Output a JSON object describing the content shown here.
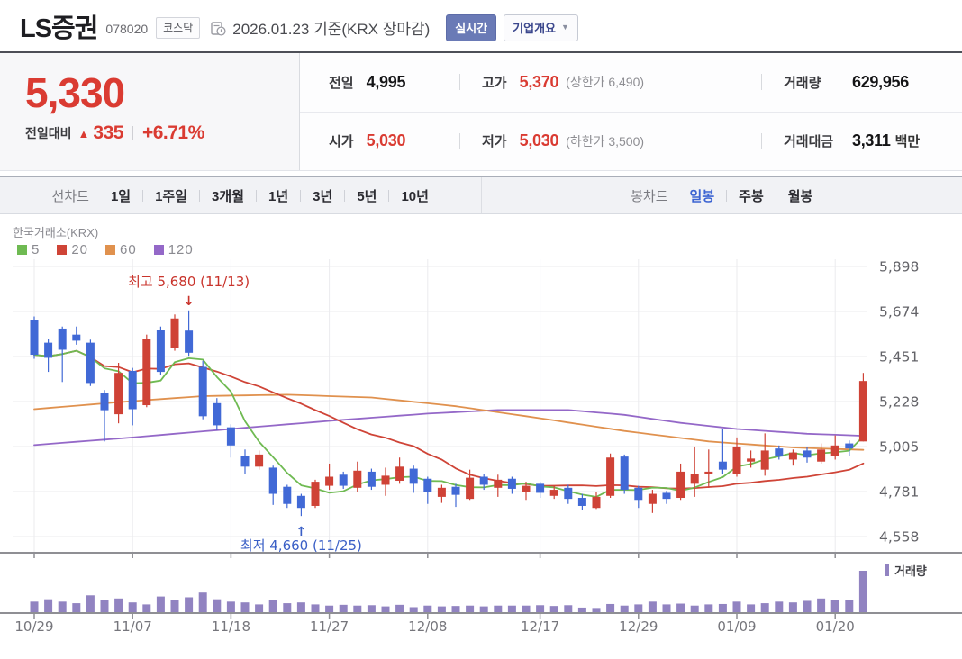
{
  "header": {
    "title": "LS증권",
    "code": "078020",
    "market_badge": "코스닥",
    "date_info": "2026.01.23  기준(KRX 장마감)",
    "realtime_badge": "실시간",
    "company_overview_button": "기업개요"
  },
  "quote": {
    "price": "5,330",
    "change_label": "전일대비",
    "change_triangle": "▲",
    "change_value": "335",
    "change_percent": "+6.71%",
    "rows": [
      {
        "cells": [
          {
            "label": "전일",
            "value": "4,995",
            "red": false,
            "sub": "",
            "suffix": ""
          },
          {
            "label": "고가",
            "value": "5,370",
            "red": true,
            "sub": "(상한가 6,490)",
            "suffix": ""
          },
          {
            "label": "거래량",
            "value": "629,956",
            "red": false,
            "sub": "",
            "suffix": ""
          }
        ]
      },
      {
        "cells": [
          {
            "label": "시가",
            "value": "5,030",
            "red": true,
            "sub": "",
            "suffix": ""
          },
          {
            "label": "저가",
            "value": "5,030",
            "red": true,
            "sub": "(하한가 3,500)",
            "suffix": ""
          },
          {
            "label": "거래대금",
            "value": "3,311",
            "red": false,
            "sub": "",
            "suffix": "백만"
          }
        ]
      }
    ]
  },
  "tabs": {
    "line_group_label": "선차트",
    "line_tabs": [
      "1일",
      "1주일",
      "3개월",
      "1년",
      "3년",
      "5년",
      "10년"
    ],
    "candle_group_label": "봉차트",
    "candle_tabs": [
      "일봉",
      "주봉",
      "월봉"
    ],
    "active_candle_tab": "일봉"
  },
  "chart_data": {
    "type": "candlestick",
    "source": "한국거래소(KRX)",
    "ma_legend": [
      {
        "label": "5",
        "color": "#6fba52"
      },
      {
        "label": "20",
        "color": "#cf4437"
      },
      {
        "label": "60",
        "color": "#e0914e"
      },
      {
        "label": "120",
        "color": "#9468c8"
      }
    ],
    "colors": {
      "up": "#cf4236",
      "down": "#4169d6",
      "volume": "#9183c1",
      "grid": "#ebebee",
      "axis": "#8f8f94",
      "label": "#6e6e73"
    },
    "y_axis": {
      "top": 5898,
      "step": 223.33,
      "tick_labels": [
        "5,898",
        "5,674",
        "5,451",
        "5,228",
        "5,005",
        "4,781",
        "4,558"
      ]
    },
    "x_ticks": [
      {
        "label": "10/29",
        "idx": 0
      },
      {
        "label": "11/07",
        "idx": 7
      },
      {
        "label": "11/18",
        "idx": 14
      },
      {
        "label": "11/27",
        "idx": 21
      },
      {
        "label": "12/08",
        "idx": 28
      },
      {
        "label": "12/17",
        "idx": 36
      },
      {
        "label": "12/29",
        "idx": 43
      },
      {
        "label": "01/09",
        "idx": 50
      },
      {
        "label": "01/20",
        "idx": 57
      }
    ],
    "annotations": {
      "high": {
        "text": "최고 5,680 (11/13)",
        "arrow": "↓",
        "idx": 11,
        "value": 5680,
        "color": "#c9342c"
      },
      "low": {
        "text": "최저 4,660 (11/25)",
        "arrow": "↑",
        "idx": 19,
        "value": 4660,
        "color": "#3a5fc6"
      }
    },
    "volume_legend": "거래량",
    "candles": [
      [
        5630,
        5650,
        5440,
        5460
      ],
      [
        5520,
        5540,
        5375,
        5445
      ],
      [
        5590,
        5600,
        5325,
        5485
      ],
      [
        5560,
        5600,
        5510,
        5530
      ],
      [
        5520,
        5535,
        5305,
        5320
      ],
      [
        5270,
        5285,
        5030,
        5185
      ],
      [
        5165,
        5420,
        5120,
        5370
      ],
      [
        5380,
        5395,
        5110,
        5190
      ],
      [
        5210,
        5560,
        5200,
        5540
      ],
      [
        5585,
        5600,
        5360,
        5375
      ],
      [
        5495,
        5660,
        5480,
        5640
      ],
      [
        5580,
        5680,
        5455,
        5470
      ],
      [
        5400,
        5430,
        5140,
        5155
      ],
      [
        5220,
        5245,
        5085,
        5110
      ],
      [
        5100,
        5115,
        4950,
        5010
      ],
      [
        4960,
        4990,
        4870,
        4905
      ],
      [
        4905,
        4985,
        4890,
        4965
      ],
      [
        4900,
        4910,
        4715,
        4770
      ],
      [
        4805,
        4815,
        4700,
        4720
      ],
      [
        4760,
        4770,
        4660,
        4700
      ],
      [
        4710,
        4840,
        4700,
        4830
      ],
      [
        4810,
        4920,
        4790,
        4855
      ],
      [
        4865,
        4880,
        4795,
        4810
      ],
      [
        4800,
        4930,
        4780,
        4885
      ],
      [
        4880,
        4895,
        4790,
        4805
      ],
      [
        4815,
        4900,
        4760,
        4860
      ],
      [
        4835,
        4950,
        4820,
        4905
      ],
      [
        4895,
        4910,
        4775,
        4820
      ],
      [
        4845,
        4855,
        4720,
        4780
      ],
      [
        4755,
        4815,
        4725,
        4800
      ],
      [
        4805,
        4820,
        4705,
        4765
      ],
      [
        4745,
        4890,
        4740,
        4850
      ],
      [
        4855,
        4870,
        4790,
        4815
      ],
      [
        4800,
        4865,
        4755,
        4840
      ],
      [
        4845,
        4855,
        4770,
        4795
      ],
      [
        4780,
        4830,
        4740,
        4810
      ],
      [
        4820,
        4830,
        4750,
        4775
      ],
      [
        4760,
        4810,
        4745,
        4790
      ],
      [
        4800,
        4815,
        4720,
        4745
      ],
      [
        4750,
        4770,
        4690,
        4710
      ],
      [
        4700,
        4780,
        4695,
        4755
      ],
      [
        4760,
        4970,
        4750,
        4950
      ],
      [
        4955,
        4965,
        4770,
        4790
      ],
      [
        4800,
        4810,
        4700,
        4740
      ],
      [
        4720,
        4790,
        4675,
        4770
      ],
      [
        4775,
        4785,
        4720,
        4745
      ],
      [
        4750,
        4920,
        4740,
        4880
      ],
      [
        4820,
        5005,
        4755,
        4870
      ],
      [
        4870,
        4990,
        4800,
        4880
      ],
      [
        4930,
        5090,
        4870,
        4890
      ],
      [
        4870,
        5050,
        4855,
        5005
      ],
      [
        4930,
        4985,
        4900,
        4945
      ],
      [
        4890,
        5070,
        4860,
        4985
      ],
      [
        4995,
        5010,
        4940,
        4955
      ],
      [
        4940,
        4990,
        4910,
        4975
      ],
      [
        4985,
        5000,
        4925,
        4950
      ],
      [
        4930,
        5020,
        4920,
        4990
      ],
      [
        4960,
        5060,
        4940,
        5010
      ],
      [
        5020,
        5035,
        4960,
        4995
      ],
      [
        5030,
        5370,
        5030,
        5330
      ]
    ],
    "ma60_points": [
      [
        0,
        5190
      ],
      [
        6,
        5225
      ],
      [
        12,
        5255
      ],
      [
        18,
        5262
      ],
      [
        24,
        5248
      ],
      [
        30,
        5205
      ],
      [
        36,
        5145
      ],
      [
        42,
        5082
      ],
      [
        48,
        5030
      ],
      [
        54,
        5000
      ],
      [
        59,
        4988
      ]
    ],
    "ma120_points": [
      [
        0,
        5012
      ],
      [
        7,
        5050
      ],
      [
        14,
        5092
      ],
      [
        21,
        5132
      ],
      [
        28,
        5168
      ],
      [
        33,
        5186
      ],
      [
        38,
        5186
      ],
      [
        42,
        5162
      ],
      [
        46,
        5122
      ],
      [
        50,
        5092
      ],
      [
        55,
        5068
      ],
      [
        59,
        5058
      ]
    ],
    "volumes": [
      0.22,
      0.28,
      0.22,
      0.18,
      0.38,
      0.25,
      0.3,
      0.2,
      0.15,
      0.35,
      0.25,
      0.33,
      0.45,
      0.28,
      0.22,
      0.2,
      0.15,
      0.25,
      0.18,
      0.2,
      0.15,
      0.12,
      0.14,
      0.12,
      0.13,
      0.1,
      0.14,
      0.08,
      0.12,
      0.1,
      0.11,
      0.12,
      0.1,
      0.12,
      0.12,
      0.12,
      0.13,
      0.11,
      0.13,
      0.07,
      0.06,
      0.16,
      0.12,
      0.15,
      0.22,
      0.15,
      0.17,
      0.12,
      0.15,
      0.16,
      0.22,
      0.15,
      0.18,
      0.22,
      0.2,
      0.24,
      0.3,
      0.26,
      0.27,
      1.0
    ]
  }
}
